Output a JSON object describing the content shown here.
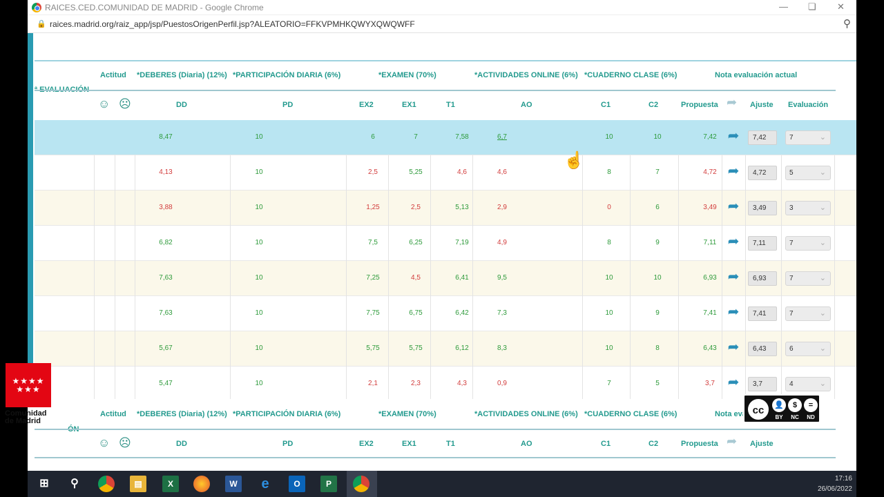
{
  "window": {
    "title": "RAICES.CED.COMUNIDAD DE MADRID - Google Chrome",
    "url": "raices.madrid.org/raiz_app/jsp/PuestosOrigenPerfil.jsp?ALEATORIO=FFKVPMHKQWYXQWQWFF"
  },
  "table": {
    "evaluation_label": "ª EVALUACIÓN",
    "group_headers": {
      "actitud": "Actitud",
      "deberes": "*DEBERES (Diaria) (12%)",
      "participacion": "*PARTICIPACIÓN DIARIA (6%)",
      "examen": "*EXAMEN (70%)",
      "actividades": "*ACTIVIDADES ONLINE (6%)",
      "cuaderno": "*CUADERNO CLASE (6%)",
      "nota": "Nota evaluación actual"
    },
    "sub_headers": {
      "dd": "DD",
      "pd": "PD",
      "ex2": "EX2",
      "ex1": "EX1",
      "t1": "T1",
      "ao": "AO",
      "c1": "C1",
      "c2": "C2",
      "propuesta": "Propuesta",
      "ajuste": "Ajuste",
      "evaluacion": "Evaluación"
    },
    "rows": [
      {
        "dd": "8,47",
        "pd": "10",
        "ex2": "6",
        "ex1": "7",
        "t1": "7,58",
        "ao": "6,7",
        "c1": "10",
        "c2": "10",
        "propuesta": "7,42",
        "ajuste": "7,42",
        "evaluacion": "7",
        "dd_c": "g",
        "ex2_c": "g",
        "ex1_c": "g",
        "t1_c": "g",
        "ao_c": "g",
        "c1_c": "g",
        "c2_c": "g",
        "prop_c": "g"
      },
      {
        "dd": "4,13",
        "pd": "10",
        "ex2": "2,5",
        "ex1": "5,25",
        "t1": "4,6",
        "ao": "4,6",
        "c1": "8",
        "c2": "7",
        "propuesta": "4,72",
        "ajuste": "4,72",
        "evaluacion": "5",
        "dd_c": "r",
        "ex2_c": "r",
        "ex1_c": "g",
        "t1_c": "r",
        "ao_c": "r",
        "c1_c": "g",
        "c2_c": "g",
        "prop_c": "r"
      },
      {
        "dd": "3,88",
        "pd": "10",
        "ex2": "1,25",
        "ex1": "2,5",
        "t1": "5,13",
        "ao": "2,9",
        "c1": "0",
        "c2": "6",
        "propuesta": "3,49",
        "ajuste": "3,49",
        "evaluacion": "3",
        "dd_c": "r",
        "ex2_c": "r",
        "ex1_c": "r",
        "t1_c": "g",
        "ao_c": "r",
        "c1_c": "r",
        "c2_c": "g",
        "prop_c": "r"
      },
      {
        "dd": "6,82",
        "pd": "10",
        "ex2": "7,5",
        "ex1": "6,25",
        "t1": "7,19",
        "ao": "4,9",
        "c1": "8",
        "c2": "9",
        "propuesta": "7,11",
        "ajuste": "7,11",
        "evaluacion": "7",
        "dd_c": "g",
        "ex2_c": "g",
        "ex1_c": "g",
        "t1_c": "g",
        "ao_c": "r",
        "c1_c": "g",
        "c2_c": "g",
        "prop_c": "g"
      },
      {
        "dd": "7,63",
        "pd": "10",
        "ex2": "7,25",
        "ex1": "4,5",
        "t1": "6,41",
        "ao": "9,5",
        "c1": "10",
        "c2": "10",
        "propuesta": "6,93",
        "ajuste": "6,93",
        "evaluacion": "7",
        "dd_c": "g",
        "ex2_c": "g",
        "ex1_c": "r",
        "t1_c": "g",
        "ao_c": "g",
        "c1_c": "g",
        "c2_c": "g",
        "prop_c": "g"
      },
      {
        "dd": "7,63",
        "pd": "10",
        "ex2": "7,75",
        "ex1": "6,75",
        "t1": "6,42",
        "ao": "7,3",
        "c1": "10",
        "c2": "9",
        "propuesta": "7,41",
        "ajuste": "7,41",
        "evaluacion": "7",
        "dd_c": "g",
        "ex2_c": "g",
        "ex1_c": "g",
        "t1_c": "g",
        "ao_c": "g",
        "c1_c": "g",
        "c2_c": "g",
        "prop_c": "g"
      },
      {
        "dd": "5,67",
        "pd": "10",
        "ex2": "5,75",
        "ex1": "5,75",
        "t1": "6,12",
        "ao": "8,3",
        "c1": "10",
        "c2": "8",
        "propuesta": "6,43",
        "ajuste": "6,43",
        "evaluacion": "6",
        "dd_c": "g",
        "ex2_c": "g",
        "ex1_c": "g",
        "t1_c": "g",
        "ao_c": "g",
        "c1_c": "g",
        "c2_c": "g",
        "prop_c": "g"
      },
      {
        "dd": "5,47",
        "pd": "10",
        "ex2": "2,1",
        "ex1": "2,3",
        "t1": "4,3",
        "ao": "0,9",
        "c1": "7",
        "c2": "5",
        "propuesta": "3,7",
        "ajuste": "3,7",
        "evaluacion": "4",
        "dd_c": "g",
        "ex2_c": "r",
        "ex1_c": "r",
        "t1_c": "r",
        "ao_c": "r",
        "c1_c": "g",
        "c2_c": "g",
        "prop_c": "r"
      }
    ],
    "second_evaluation_label": "ÓN"
  },
  "logo": {
    "stars": "★★★★\n ★★★",
    "name_line1": "Comunidad",
    "name_line2": "de Madrid"
  },
  "license": {
    "main": "cc",
    "by": "BY",
    "nc": "NC",
    "nd": "ND"
  },
  "taskbar": {
    "time": "17:16",
    "date": "26/06/2022"
  },
  "colors": {
    "accent": "#2a9bb2",
    "selected_row": "#b9e5f2",
    "alt_row": "#fbf8ea",
    "good": "#2d9a3a",
    "bad": "#d23c3c",
    "header": "#239a8e"
  }
}
